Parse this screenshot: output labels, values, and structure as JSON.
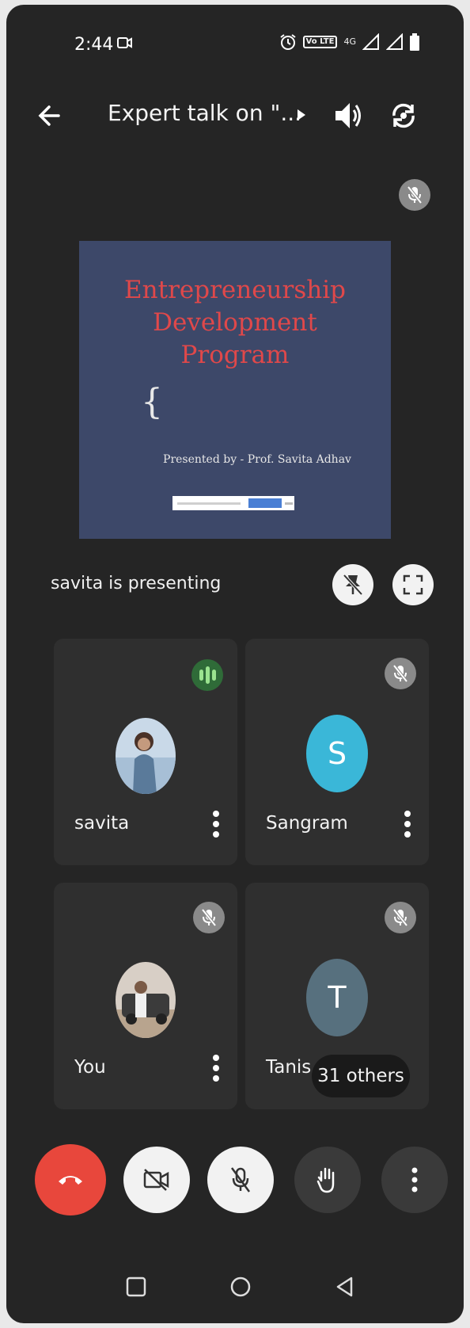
{
  "status_bar": {
    "time": "2:44",
    "network": "4G",
    "lte_badge": "Vo LTE"
  },
  "top_bar": {
    "title": "Expert talk on \"...",
    "icons": [
      "back-arrow-icon",
      "play-arrow-icon",
      "speaker-icon",
      "flip-camera-icon"
    ]
  },
  "presentation": {
    "slide_title_lines": [
      "Entrepreneurship",
      "Development",
      "Program"
    ],
    "slide_brace": "{",
    "slide_presenter": "Presented by - Prof. Savita Adhav",
    "presenting_label": "savita is presenting"
  },
  "participants": [
    {
      "name": "savita",
      "avatar": "photo",
      "speaking": true
    },
    {
      "name": "Sangram",
      "avatar": "letter",
      "letter": "S",
      "color": "#3ab7d8",
      "muted": true
    },
    {
      "name": "You",
      "avatar": "photo",
      "muted": true
    },
    {
      "name": "Tanis",
      "avatar": "letter",
      "letter": "T",
      "color": "#57707e",
      "muted": true
    }
  ],
  "others_chip": "31 others",
  "controls": {
    "end_call_color": "#e8473c",
    "buttons": [
      "end-call",
      "camera-off",
      "mic-off",
      "raise-hand",
      "more-options"
    ]
  },
  "colors": {
    "background": "#252525",
    "tile": "#2f2f2f",
    "slide_bg": "#3d4869",
    "slide_title": "#e0484a",
    "speaking_green": "#2f6b38"
  }
}
